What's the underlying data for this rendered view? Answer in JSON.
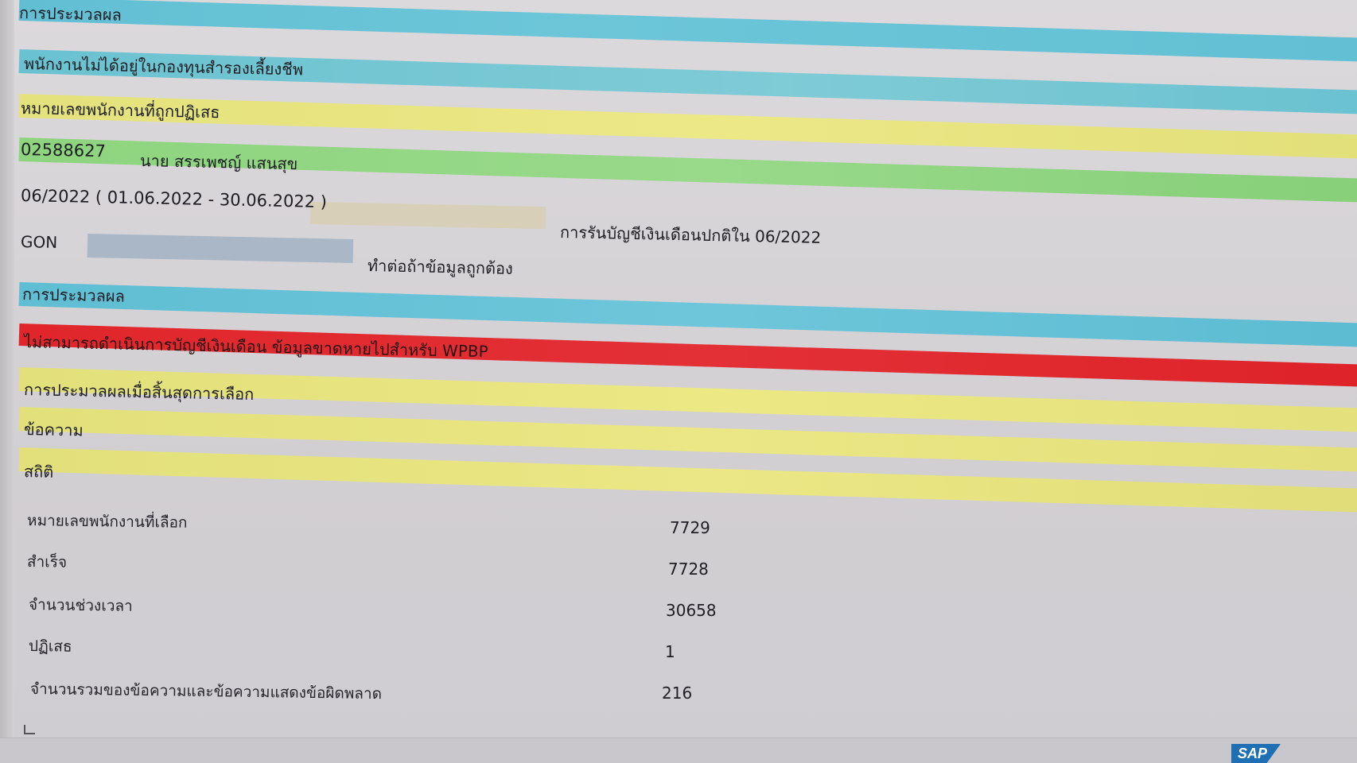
{
  "colors": {
    "header_bar": "#6cc3d5",
    "success_bar": "#7ccfcf",
    "warning_bar": "#e6e37a",
    "ok_bar": "#8fd47f",
    "error_bar": "#e0262b",
    "period_chip": "#d6cdb3",
    "input_chip": "#a9b8c8",
    "sap_brand": "#1f6fb5"
  },
  "log": {
    "heading_processing": "การประมวลผล",
    "not_in_fund": "พนักงานไม่ได้อยู่ในกองทุนสำรองเลี้ยงชีพ",
    "rejected_ids_heading": "หมายเลขพนักงานที่ถูกปฏิเสธ",
    "employee_id": "02588627",
    "employee_name": "นาย สรรเพชญ์ แสนสุข",
    "period": "06/2022 ( 01.06.2022 - 30.06.2022 )",
    "period_note": "การรันบัญชีเงินเดือนปกติใน 06/2022",
    "gon_label": "GON",
    "continue_note": "ทำต่อถ้าข้อมูลถูกต้อง",
    "heading_processing_2": "การประมวลผล",
    "error_message": "ไม่สามารถดำเนินการบัญชีเงินเดือน ข้อมูลขาดหายไปสำหรับ WPBP",
    "end_selection": "การประมวลผลเมื่อสิ้นสุดการเลือก",
    "messages": "ข้อความ",
    "statistics": "สถิติ"
  },
  "stats": [
    {
      "label": "หมายเลขพนักงานที่เลือก",
      "value": "7729"
    },
    {
      "label": "สำเร็จ",
      "value": "7728"
    },
    {
      "label": "จำนวนช่วงเวลา",
      "value": "30658"
    },
    {
      "label": "ปฏิเสธ",
      "value": "1"
    },
    {
      "label": "จำนวนรวมของข้อความและข้อความแสดงข้อผิดพลาด",
      "value": "216"
    }
  ],
  "brand": {
    "logo_text": "SAP"
  }
}
